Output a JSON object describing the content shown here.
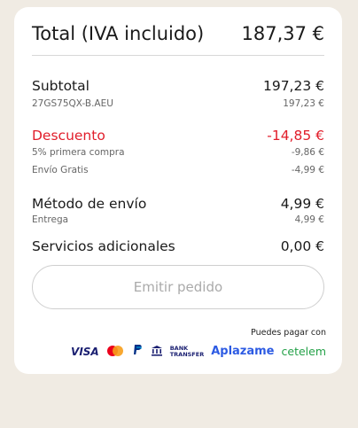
{
  "total": {
    "label": "Total (IVA incluido)",
    "value": "187,37 €"
  },
  "subtotal": {
    "label": "Subtotal",
    "value": "197,23 €",
    "item_code": "27GS75QX-B.AEU",
    "item_value": "197,23 €"
  },
  "discount": {
    "label": "Descuento",
    "value": "-14,85 €",
    "items": [
      {
        "label": "5% primera compra",
        "value": "-9,86 €"
      },
      {
        "label": "Envío Gratis",
        "value": "-4,99 €"
      }
    ]
  },
  "shipping": {
    "label": "Método de envío",
    "value": "4,99 €",
    "sub_label": "Entrega",
    "sub_value": "4,99 €"
  },
  "extras": {
    "label": "Servicios adicionales",
    "value": "0,00 €"
  },
  "submit_button": "Emitir pedido",
  "payment": {
    "note": "Puedes pagar con",
    "visa": "VISA",
    "bank_line1": "BANK",
    "bank_line2": "TRANSFER",
    "aplazame": "Aplazame",
    "cetelem": "cetelem"
  },
  "colors": {
    "accent_red": "#e11d2a",
    "background": "#f0ebe3"
  }
}
